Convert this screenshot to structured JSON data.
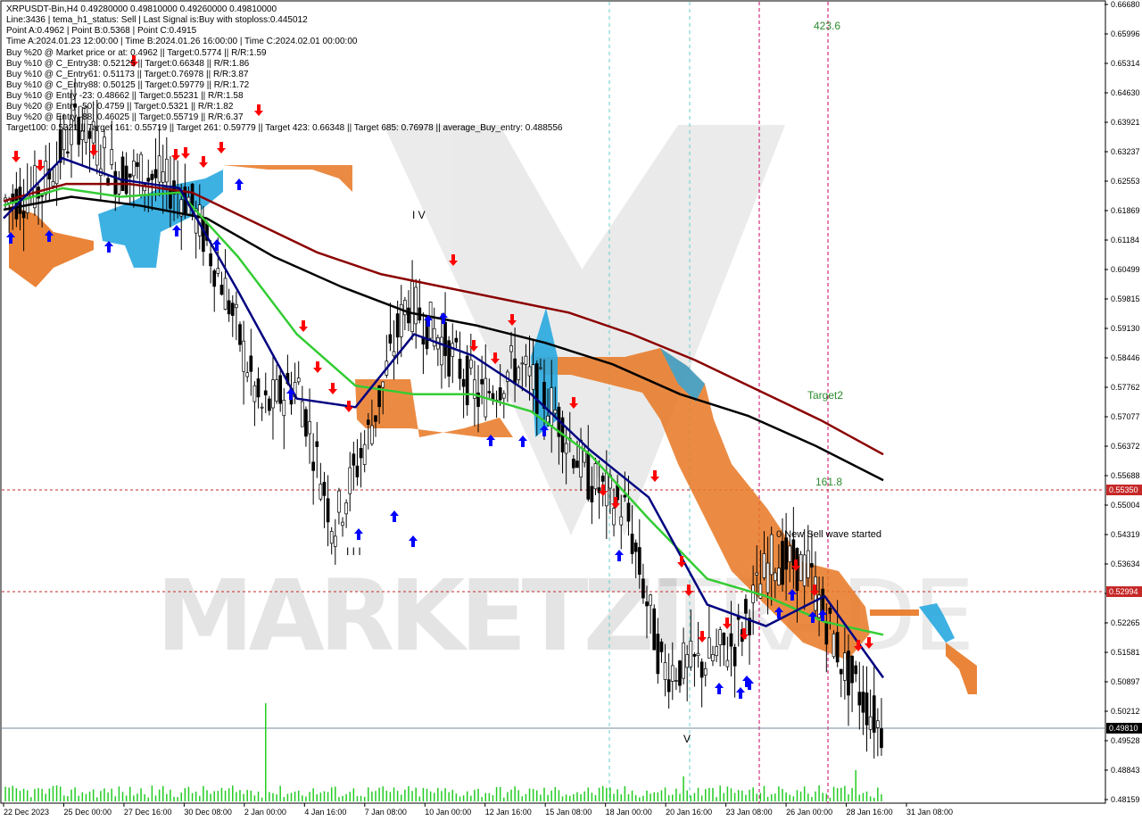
{
  "info_lines": [
    "XRPUSDT-Bin,H4  0.49280000 0.49810000 0.49260000 0.49810000",
    "Line:3436 | tema_h1_status: Sell | Last Signal is:Buy with stoploss:0.445012",
    "Point A:0.4962 | Point B:0.5368 | Point C:0.4915",
    "Time A:2024.01.23 12:00:00 | Time B:2024.01.26 16:00:00 | Time C:2024.02.01 00:00:00",
    "Buy %20 @ Market price or at: 0.4962 || Target:0.5774 || R/R:1.59",
    "Buy %10 @ C_Entry38: 0.52125 || Target:0.66348 || R/R:1.86",
    "Buy %10 @ C_Entry61: 0.51173 || Target:0.76978 || R/R:3.87",
    "Buy %10 @ C_Entry88: 0.50125 || Target:0.59779 || R/R:1.72",
    "Buy %10 @ Entry -23: 0.48662 || Target:0.55231 || R/R:1.58",
    "Buy %20 @ Entry -50: 0.4759 || Target:0.5321 || R/R:1.82",
    "Buy %20 @ Entry -88: 0.46025 || Target:0.55719 || R/R:6.37",
    "Target100: 0.5321 || Target 161: 0.55719 || Target 261: 0.59779 || Target 423: 0.66348 || Target 685: 0.76978 || average_Buy_entry: 0.488556"
  ],
  "y_axis_labels": [
    "0.66680",
    "0.65996",
    "0.65314",
    "0.64630",
    "0.63921",
    "0.63237",
    "0.62553",
    "0.61869",
    "0.61184",
    "0.60499",
    "0.59815",
    "0.59130",
    "0.58446",
    "0.57762",
    "0.57077",
    "0.56372",
    "0.55688",
    "0.55004",
    "0.54319",
    "0.53634",
    "0.52950",
    "0.52265",
    "0.51581",
    "0.50897",
    "0.50212",
    "0.49528",
    "0.48843",
    "0.48159"
  ],
  "x_axis_labels": [
    "22 Dec 2023",
    "25 Dec 00:00",
    "27 Dec 16:00",
    "30 Dec 08:00",
    "2 Jan 00:00",
    "4 Jan 16:00",
    "7 Jan 08:00",
    "10 Jan 00:00",
    "12 Jan 16:00",
    "15 Jan 08:00",
    "18 Jan 00:00",
    "20 Jan 16:00",
    "23 Jan 08:00",
    "26 Jan 00:00",
    "28 Jan 16:00",
    "31 Jan 08:00"
  ],
  "price_tags": [
    {
      "value": "0.55350",
      "color": "#c62828"
    },
    {
      "value": "0.52994",
      "color": "#c62828"
    },
    {
      "value": "0.49810",
      "color": "#000000"
    }
  ],
  "annotations": {
    "t423": "423.6",
    "target2": "Target2",
    "t161": "161.8",
    "new_sell": "0 New Sell wave started"
  },
  "watermark": {
    "left": "MARKETZI",
    "right": "TRADE"
  },
  "colors": {
    "up_arrow": "#0000ff",
    "down_arrow": "#ff0000",
    "ma_dark_red": "#8b0000",
    "ma_black": "#000000",
    "ma_green": "#33cc33",
    "ma_navy": "#000080",
    "cloud_orange": "#e87722",
    "cloud_blue": "#29a8e0",
    "text_green": "#2e8b2e"
  },
  "chart_data": {
    "type": "line",
    "symbol": "XRPUSDT-Bin",
    "timeframe": "H4",
    "ohlc_last": {
      "open": 0.4928,
      "high": 0.4981,
      "low": 0.4926,
      "close": 0.4981
    },
    "ylim": [
      0.4816,
      0.6668
    ],
    "x_categories": [
      "22 Dec 2023",
      "25 Dec 00:00",
      "27 Dec 16:00",
      "30 Dec 08:00",
      "2 Jan 00:00",
      "4 Jan 16:00",
      "7 Jan 08:00",
      "10 Jan 00:00",
      "12 Jan 16:00",
      "15 Jan 08:00",
      "18 Jan 00:00",
      "20 Jan 16:00",
      "23 Jan 08:00",
      "26 Jan 00:00",
      "28 Jan 16:00",
      "31 Jan 08:00"
    ],
    "price_path": [
      0.621,
      0.624,
      0.64,
      0.628,
      0.627,
      0.622,
      0.601,
      0.572,
      0.579,
      0.545,
      0.568,
      0.598,
      0.588,
      0.575,
      0.583,
      0.573,
      0.556,
      0.549,
      0.512,
      0.513,
      0.518,
      0.538,
      0.535,
      0.512,
      0.4981
    ],
    "series": [
      {
        "values": [
          0.621,
          0.625,
          0.625,
          0.623,
          0.616,
          0.609,
          0.604,
          0.601,
          0.598,
          0.595,
          0.59,
          0.584,
          0.577,
          0.57,
          0.562
        ]
      },
      {
        "values": [
          0.619,
          0.622,
          0.62,
          0.617,
          0.608,
          0.601,
          0.595,
          0.592,
          0.588,
          0.583,
          0.576,
          0.571,
          0.564,
          0.556
        ]
      },
      {
        "values": [
          0.62,
          0.624,
          0.622,
          0.623,
          0.608,
          0.59,
          0.578,
          0.576,
          0.576,
          0.572,
          0.562,
          0.547,
          0.533,
          0.529,
          0.523,
          0.52
        ]
      },
      {
        "values": [
          0.617,
          0.631,
          0.626,
          0.624,
          0.6,
          0.575,
          0.573,
          0.59,
          0.585,
          0.576,
          0.563,
          0.552,
          0.527,
          0.522,
          0.529,
          0.51
        ]
      }
    ],
    "horizontal_levels": [
      0.5535,
      0.52994,
      0.4981
    ]
  }
}
